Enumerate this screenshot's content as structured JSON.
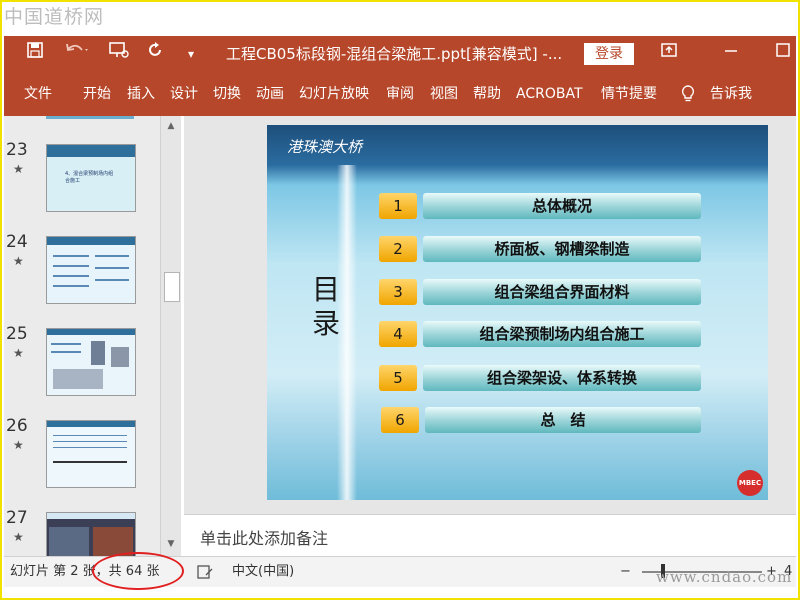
{
  "watermark_top": "中国道桥网",
  "watermark_bottom": "www.cndao.com",
  "titlebar": {
    "doc_title": "工程CB05标段钢-混组合梁施工.ppt[兼容模式]  -...",
    "login_label": "登录",
    "icons": [
      "save-icon",
      "undo-icon",
      "present-icon",
      "redo-icon",
      "customize-icon",
      "ribbon-display-icon",
      "minimize-icon",
      "maximize-icon"
    ]
  },
  "ribbon": {
    "tabs": [
      "文件",
      "开始",
      "插入",
      "设计",
      "切换",
      "动画",
      "幻灯片放映",
      "审阅",
      "视图",
      "帮助",
      "ACROBAT",
      "情节提要"
    ],
    "tell_me": "告诉我"
  },
  "thumbnails": [
    {
      "num": "23",
      "star": "★",
      "text": "4、混合梁预制场内组合施工"
    },
    {
      "num": "24",
      "star": "★"
    },
    {
      "num": "25",
      "star": "★"
    },
    {
      "num": "26",
      "star": "★"
    },
    {
      "num": "27",
      "star": "★"
    }
  ],
  "slide": {
    "logo_text": "港珠澳大桥",
    "heading": "目录",
    "items": [
      {
        "num": "1",
        "label": "总体概况"
      },
      {
        "num": "2",
        "label": "桥面板、钢槽梁制造"
      },
      {
        "num": "3",
        "label": "组合梁组合界面材料"
      },
      {
        "num": "4",
        "label": "组合梁预制场内组合施工"
      },
      {
        "num": "5",
        "label": "组合梁架设、体系转换"
      },
      {
        "num": "6",
        "label": "总　结"
      }
    ],
    "badge": "MBEC"
  },
  "notes_placeholder": "单击此处添加备注",
  "statusbar": {
    "slide_counter": "幻灯片 第 2 张，共 64 张",
    "language": "中文(中国)",
    "zoom_minus": "−",
    "zoom_plus": "+",
    "zoom_value": "4"
  },
  "colors": {
    "accent": "#b7472a",
    "highlight_ring": "#e02020",
    "frame_border": "#f2e200"
  }
}
